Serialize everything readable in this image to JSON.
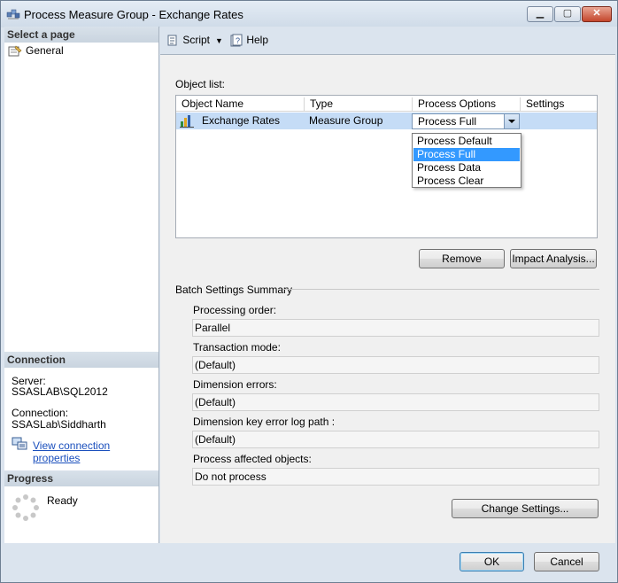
{
  "window": {
    "title": "Process Measure Group - Exchange Rates"
  },
  "left": {
    "select_page_header": "Select a page",
    "pages": [
      {
        "label": "General"
      }
    ],
    "connection_header": "Connection",
    "server_label": "Server:",
    "server_value": "SSASLAB\\SQL2012",
    "connection_label": "Connection:",
    "connection_value": "SSASLab\\Siddharth",
    "view_connection_link": "View connection properties",
    "progress_header": "Progress",
    "progress_status": "Ready"
  },
  "toolbar": {
    "script_label": "Script",
    "help_label": "Help"
  },
  "object_list": {
    "label": "Object list:",
    "columns": [
      "Object Name",
      "Type",
      "Process Options",
      "Settings"
    ],
    "rows": [
      {
        "name": "Exchange Rates",
        "type": "Measure Group",
        "process_option": "Process Full",
        "settings": ""
      }
    ],
    "dropdown_options": [
      "Process Default",
      "Process Full",
      "Process Data",
      "Process Clear"
    ],
    "selected_option": "Process Full"
  },
  "buttons": {
    "remove": "Remove",
    "impact_analysis": "Impact Analysis...",
    "change_settings": "Change Settings...",
    "ok": "OK",
    "cancel": "Cancel"
  },
  "batch": {
    "title": "Batch Settings Summary",
    "items": [
      {
        "label": "Processing order:",
        "value": "Parallel"
      },
      {
        "label": "Transaction mode:",
        "value": "(Default)"
      },
      {
        "label": "Dimension errors:",
        "value": "(Default)"
      },
      {
        "label": "Dimension key error log path :",
        "value": "(Default)"
      },
      {
        "label": "Process affected objects:",
        "value": "Do not process"
      }
    ]
  },
  "colors": {
    "selection_row": "#c5dcf6",
    "dropdown_highlight": "#3399ff",
    "link": "#1a4fbd",
    "close_button": "#c4462c"
  }
}
